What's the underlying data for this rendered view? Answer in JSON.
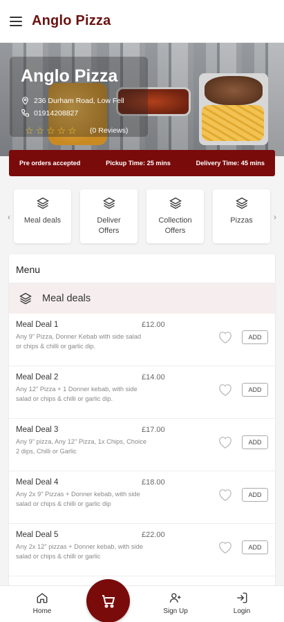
{
  "app": {
    "title": "Anglo Pizza"
  },
  "hero": {
    "name": "Anglo Pizza",
    "address": "236 Durham Road, Low Fell",
    "phone": "01914208827",
    "rating_stars": 0,
    "reviews": "(0 Reviews)"
  },
  "banner": {
    "preorder": "Pre orders accepted",
    "pickup": "Pickup Time: 25 mins",
    "delivery": "Delivery Time: 45 mins"
  },
  "categories": [
    {
      "label": "Meal deals",
      "icon": "layers-icon"
    },
    {
      "label": "Deliver Offers",
      "icon": "layers-icon"
    },
    {
      "label": "Collection Offers",
      "icon": "layers-icon"
    },
    {
      "label": "Pizzas",
      "icon": "layers-icon"
    }
  ],
  "menu": {
    "heading": "Menu",
    "section": "Meal deals",
    "add_label": "ADD",
    "items": [
      {
        "name": "Meal Deal 1",
        "price": "£12.00",
        "desc": "Any 9\" Pizza, Donner Kebab with side salad or chips & chilli or garlic dip."
      },
      {
        "name": "Meal Deal 2",
        "price": "£14.00",
        "desc": "Any 12\" Pizza + 1 Donner kebab, with side salad or chips & chilli or garlic dip."
      },
      {
        "name": "Meal Deal 3",
        "price": "£17.00",
        "desc": "Any 9\" pizza, Any 12\" Pizza, 1x Chips, Choice 2 dips, Chilli or Garlic"
      },
      {
        "name": "Meal Deal 4",
        "price": "£18.00",
        "desc": "Any 2x 9\" Pizzas + Donner kebab, with side salad or chips & chilli or garlic dip"
      },
      {
        "name": "Meal Deal 5",
        "price": "£22.00",
        "desc": "Any 2x 12\" pizzas + Donner kebab, with side salad or chips & chilli or garlic"
      }
    ]
  },
  "nav": {
    "home": "Home",
    "signup": "Sign Up",
    "login": "Login"
  },
  "colors": {
    "brand": "#7a0b0b",
    "title": "#6b1111",
    "star": "#f3c623"
  }
}
